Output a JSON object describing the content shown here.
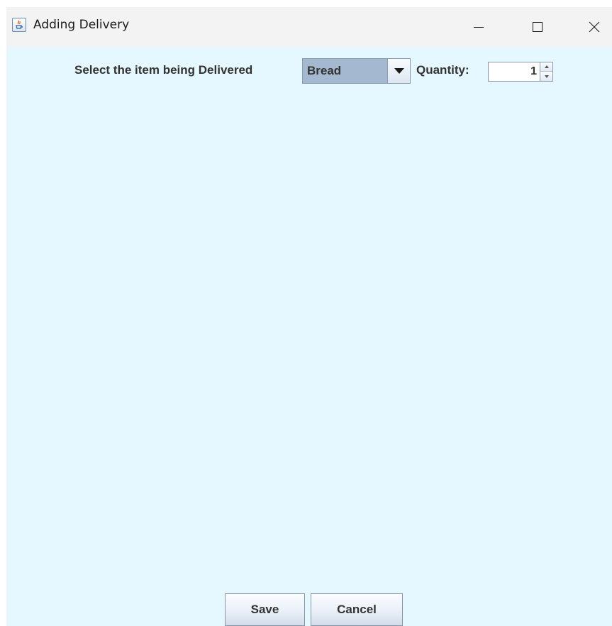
{
  "window": {
    "title": "Adding Delivery",
    "icon": "java-icon"
  },
  "form": {
    "item_label": "Select the item being Delivered",
    "item_selected": "Bread",
    "quantity_label": "Quantity:",
    "quantity_value": "1"
  },
  "buttons": {
    "save": "Save",
    "cancel": "Cancel"
  },
  "colors": {
    "content_background": "#e6f8ff",
    "titlebar_background": "#f3f3f3",
    "combo_background": "#a4b8cf"
  }
}
